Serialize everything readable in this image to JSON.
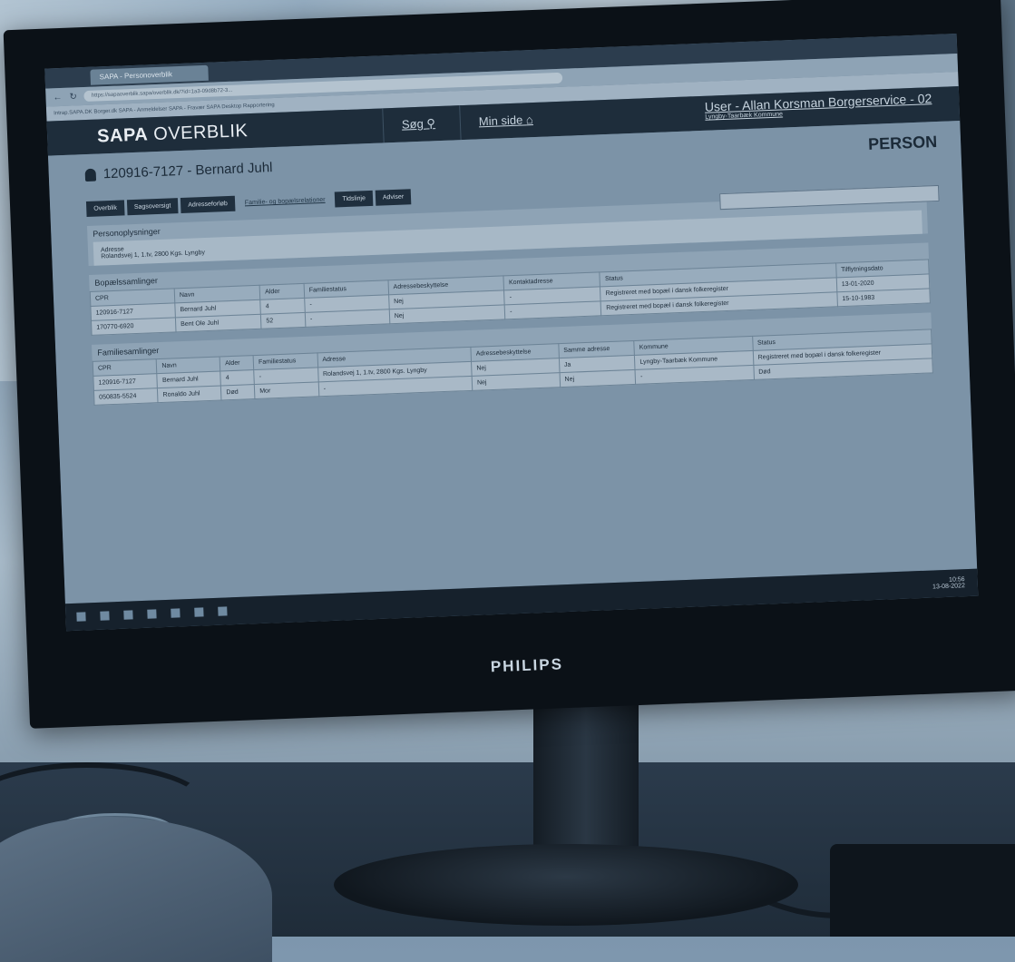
{
  "monitor": {
    "brand": "PHILIPS"
  },
  "browser": {
    "tab_title": "SAPA - Personoverblik",
    "url": "https://sapaoverblik.sapa/overblik.dk/?id=1a3-09d8b72-3...",
    "bookmarks": "Intrap.SAPA.DK   Borger.dk   SAPA - Anmeldelser   SAPA - Fravær   SAPA Desktop   Rapportering"
  },
  "app": {
    "logo_bold": "SAPA",
    "logo_rest": " OVERBLIK",
    "search_link": "Søg",
    "my_page_link": "Min side",
    "user_line1": "User - Allan Korsman Borgerservice - 02",
    "user_line2": "Lyngby-Taarbæk Kommune"
  },
  "person": {
    "id_name": "120916-7127 - Bernard Juhl",
    "label": "PERSON"
  },
  "tabs": [
    "Overblik",
    "Sagsoversigt",
    "Adresseforløb",
    "Familie- og bopælsrelationer",
    "Tidslinje",
    "Adviser"
  ],
  "sections": {
    "personoplysninger": "Personoplysninger",
    "address_label": "Adresse",
    "address_value": "Rolandsvej 1, 1.tv, 2800 Kgs. Lyngby",
    "bopael": "Bopælssamlinger",
    "familie": "Familiesamlinger"
  },
  "table1": {
    "headers": [
      "CPR",
      "Navn",
      "Alder",
      "Familiestatus",
      "Adressebeskyttelse",
      "Kontaktadresse",
      "Status",
      "Tilflytningsdato"
    ],
    "rows": [
      [
        "120916-7127",
        "Bernard Juhl",
        "4",
        "-",
        "Nej",
        "-",
        "Registreret med bopæl i dansk folkeregister",
        "13-01-2020"
      ],
      [
        "170770-6920",
        "Bent Ole Juhl",
        "52",
        "-",
        "Nej",
        "-",
        "Registreret med bopæl i dansk folkeregister",
        "15-10-1983"
      ]
    ]
  },
  "table2": {
    "headers": [
      "CPR",
      "Navn",
      "Alder",
      "Familiestatus",
      "Adresse",
      "Adressebeskyttelse",
      "Samme adresse",
      "Kommune",
      "Status"
    ],
    "rows": [
      [
        "120916-7127",
        "Bernard Juhl",
        "4",
        "-",
        "Rolandsvej 1, 1.tv, 2800 Kgs. Lyngby",
        "Nej",
        "Ja",
        "Lyngby-Taarbæk Kommune",
        "Registreret med bopæl i dansk folkeregister"
      ],
      [
        "050835-5524",
        "Ronaldo Juhl",
        "Død",
        "Mor",
        "-",
        "Nej",
        "Nej",
        "-",
        "Død"
      ]
    ]
  },
  "clock": {
    "time": "10:56",
    "date": "13-08-2022"
  }
}
